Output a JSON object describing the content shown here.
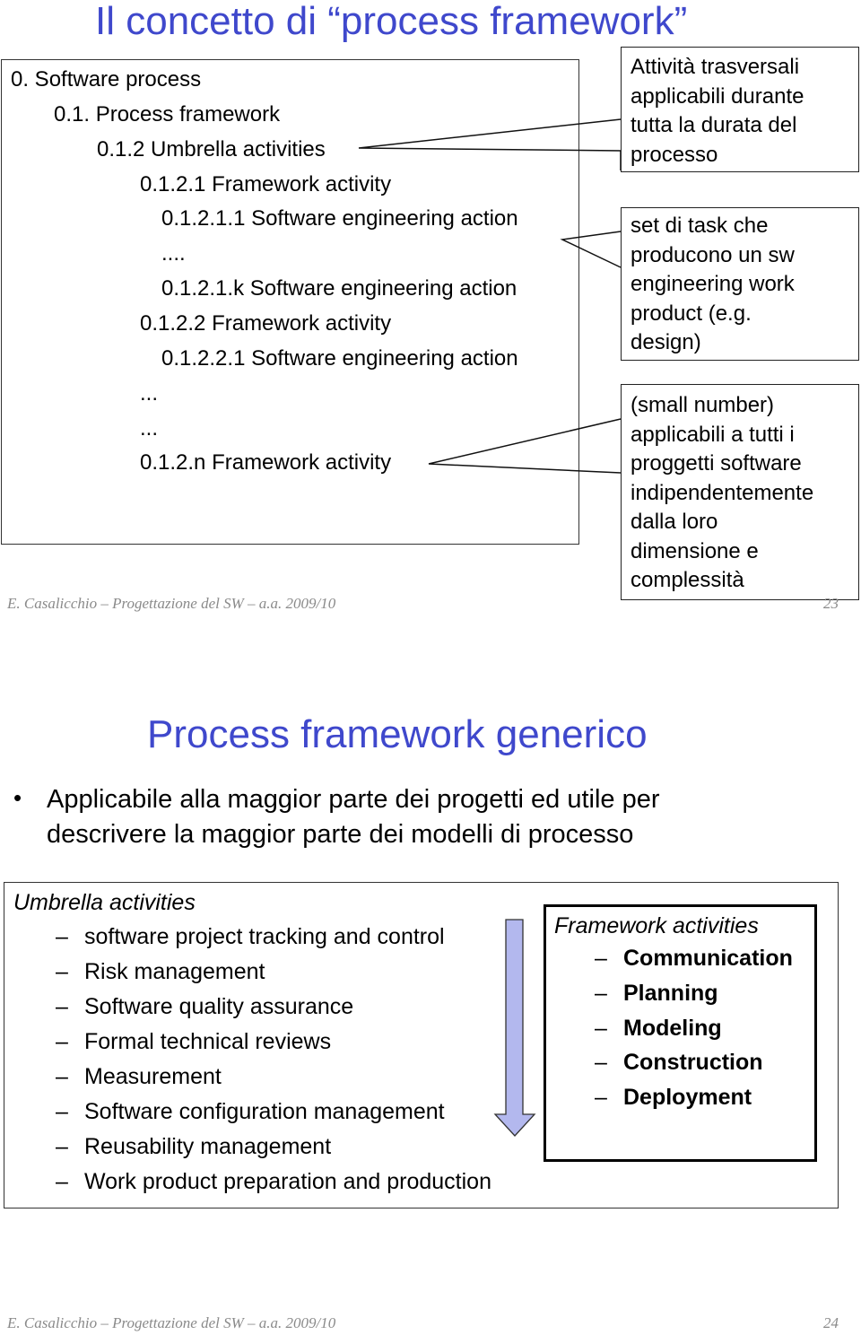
{
  "slide1": {
    "title": "Il concetto di “process framework”",
    "tree": [
      {
        "label": "0. Software process"
      },
      {
        "label": "0.1. Process framework"
      },
      {
        "label": "0.1.2 Umbrella activities"
      },
      {
        "label": "0.1.2.1 Framework activity"
      },
      {
        "label": "0.1.2.1.1 Software engineering action"
      },
      {
        "label": "...."
      },
      {
        "label": "0.1.2.1.k Software engineering action"
      },
      {
        "label": "0.1.2.2 Framework activity"
      },
      {
        "label": "0.1.2.2.1 Software engineering action"
      },
      {
        "label": "..."
      },
      {
        "label": "..."
      },
      {
        "label": "0.1.2.n Framework activity"
      }
    ],
    "callouts": [
      {
        "lines": [
          "Attività trasversali",
          "applicabili durante",
          "tutta la durata del",
          "processo"
        ]
      },
      {
        "lines": [
          "set di task che",
          "producono un sw",
          "engineering work",
          "product (e.g.",
          "design)"
        ]
      },
      {
        "lines": [
          "(small number)",
          "applicabili a tutti i",
          "proggetti software",
          "indipendentemente",
          "dalla loro",
          "dimensione e",
          "complessità"
        ]
      }
    ],
    "footer": "E. Casalicchio – Progettazione del SW – a.a. 2009/10",
    "page_number": "23"
  },
  "slide2": {
    "title": "Process framework generico",
    "bullet": "Applicabile alla maggior parte dei progetti ed utile per descrivere la maggior parte dei modelli di processo",
    "bullet_lines": [
      "Applicabile alla maggior parte dei progetti ed utile per",
      "descrivere la maggior parte dei modelli di processo"
    ],
    "umbrella": {
      "heading": "Umbrella activities",
      "dash": "–",
      "items": [
        "software project tracking and control",
        "Risk management",
        "Software quality assurance",
        "Formal technical reviews",
        "Measurement",
        "Software configuration management",
        "Reusability management",
        "Work product preparation and production"
      ]
    },
    "framework": {
      "heading": "Framework activities",
      "dash": "–",
      "items": [
        "Communication",
        "Planning",
        "Modeling",
        "Construction",
        "Deployment"
      ]
    },
    "arrow_color": "#b3b8ee",
    "footer": "E. Casalicchio – Progettazione del SW – a.a. 2009/10",
    "page_number": "24"
  },
  "colors": {
    "title": "#3f48cc",
    "footer": "#8a8a8a"
  }
}
